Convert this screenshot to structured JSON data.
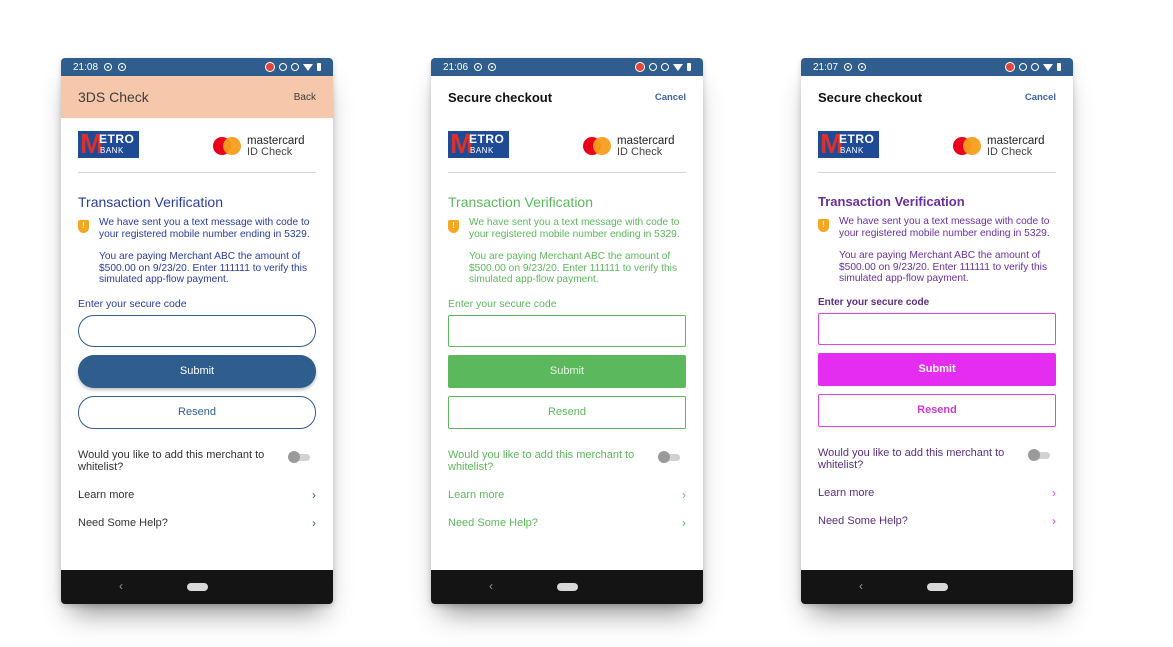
{
  "colors": {
    "status_bar": "#2f5d8e",
    "phone1_header": "#f6c7ab",
    "phone1_accent": "#2f5d8e",
    "phone2_accent": "#5cb85c",
    "phone3_accent": "#e42df0",
    "phone3_text": "#6a2fa0"
  },
  "phones": [
    {
      "time": "21:08",
      "header_title": "3DS Check",
      "header_action": "Back",
      "bank_logo": {
        "mark": "M",
        "line1": "ETRO",
        "line2": "BANK"
      },
      "network_logo": {
        "line1": "mastercard",
        "line2": "ID Check"
      },
      "title": "Transaction Verification",
      "message1": "We have sent you a text message with code to your registered mobile number ending in 5329.",
      "message2": "You are paying Merchant ABC the amount of $500.00 on 9/23/20. Enter 111111 to verify this simulated app-flow payment.",
      "code_label": "Enter your secure code",
      "code_value": "",
      "submit_label": "Submit",
      "resend_label": "Resend",
      "whitelist_label": "Would you like to add this merchant to whitelist?",
      "learn_more": "Learn more",
      "help": "Need Some Help?"
    },
    {
      "time": "21:06",
      "header_title": "Secure checkout",
      "header_action": "Cancel",
      "bank_logo": {
        "mark": "M",
        "line1": "ETRO",
        "line2": "BANK"
      },
      "network_logo": {
        "line1": "mastercard",
        "line2": "ID Check"
      },
      "title": "Transaction Verification",
      "message1": "We have sent you a text message with code to your registered mobile number ending in 5329.",
      "message2": "You are paying Merchant ABC the amount of $500.00 on 9/23/20. Enter 111111 to verify this simulated app-flow payment.",
      "code_label": "Enter your secure code",
      "code_value": "",
      "submit_label": "Submit",
      "resend_label": "Resend",
      "whitelist_label": "Would you like to add this merchant to whitelist?",
      "learn_more": "Learn more",
      "help": "Need Some Help?"
    },
    {
      "time": "21:07",
      "header_title": "Secure checkout",
      "header_action": "Cancel",
      "bank_logo": {
        "mark": "M",
        "line1": "ETRO",
        "line2": "BANK"
      },
      "network_logo": {
        "line1": "mastercard",
        "line2": "ID Check"
      },
      "title": "Transaction Verification",
      "message1": "We have sent you a text message with code to your registered mobile number ending in 5329.",
      "message2": "You are paying Merchant ABC the amount of $500.00 on 9/23/20. Enter 111111 to verify this simulated app-flow payment.",
      "code_label": "Enter your secure code",
      "code_value": "",
      "submit_label": "Submit",
      "resend_label": "Resend",
      "whitelist_label": "Would you like to add this merchant to whitelist?",
      "learn_more": "Learn more",
      "help": "Need Some Help?"
    }
  ],
  "nav": {
    "back_glyph": "‹"
  },
  "icons": {
    "alert": "shield-alert-icon",
    "chevron": "chevron-right-icon",
    "chevron_glyph": "›",
    "alert_glyph": "!"
  }
}
